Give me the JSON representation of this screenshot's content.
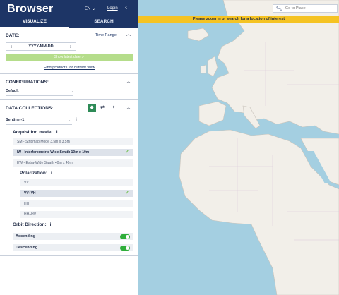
{
  "header": {
    "brand": "Browser",
    "language": "EN",
    "login": "Login",
    "tabs": [
      "VISUALIZE",
      "SEARCH"
    ]
  },
  "date": {
    "title": "DATE:",
    "time_range": "Time Range",
    "value": "YYYY-MM-DD",
    "show_latest": "Show latest date",
    "find_products": "Find products for current view"
  },
  "configurations": {
    "title": "CONFIGURATIONS:",
    "selected": "Default"
  },
  "collections": {
    "title": "DATA COLLECTIONS:",
    "selected": "Sentinel-1",
    "acquisition_label": "Acquisition mode:",
    "acquisition_modes": [
      "SM - Stripmap Mode 3.5m x 3.5m",
      "IW - Interferometric Wide Swath 10m x 10m",
      "EW - Extra-Wide Swath 40m x 40m"
    ],
    "polarization_label": "Polarization:",
    "polarizations": [
      "VV",
      "VV+VH",
      "HH",
      "HH+HV"
    ],
    "orbit_label": "Orbit Direction:",
    "orbits": [
      "Ascending",
      "Descending"
    ]
  },
  "map": {
    "banner": "Please zoom in or search for a location of interest",
    "search_placeholder": "Go to Place",
    "colors": {
      "water": "#a4cfe1",
      "land": "#f2efe9",
      "banner": "#f5c323",
      "header": "#1d3566",
      "toggle": "#2fae3a"
    }
  }
}
